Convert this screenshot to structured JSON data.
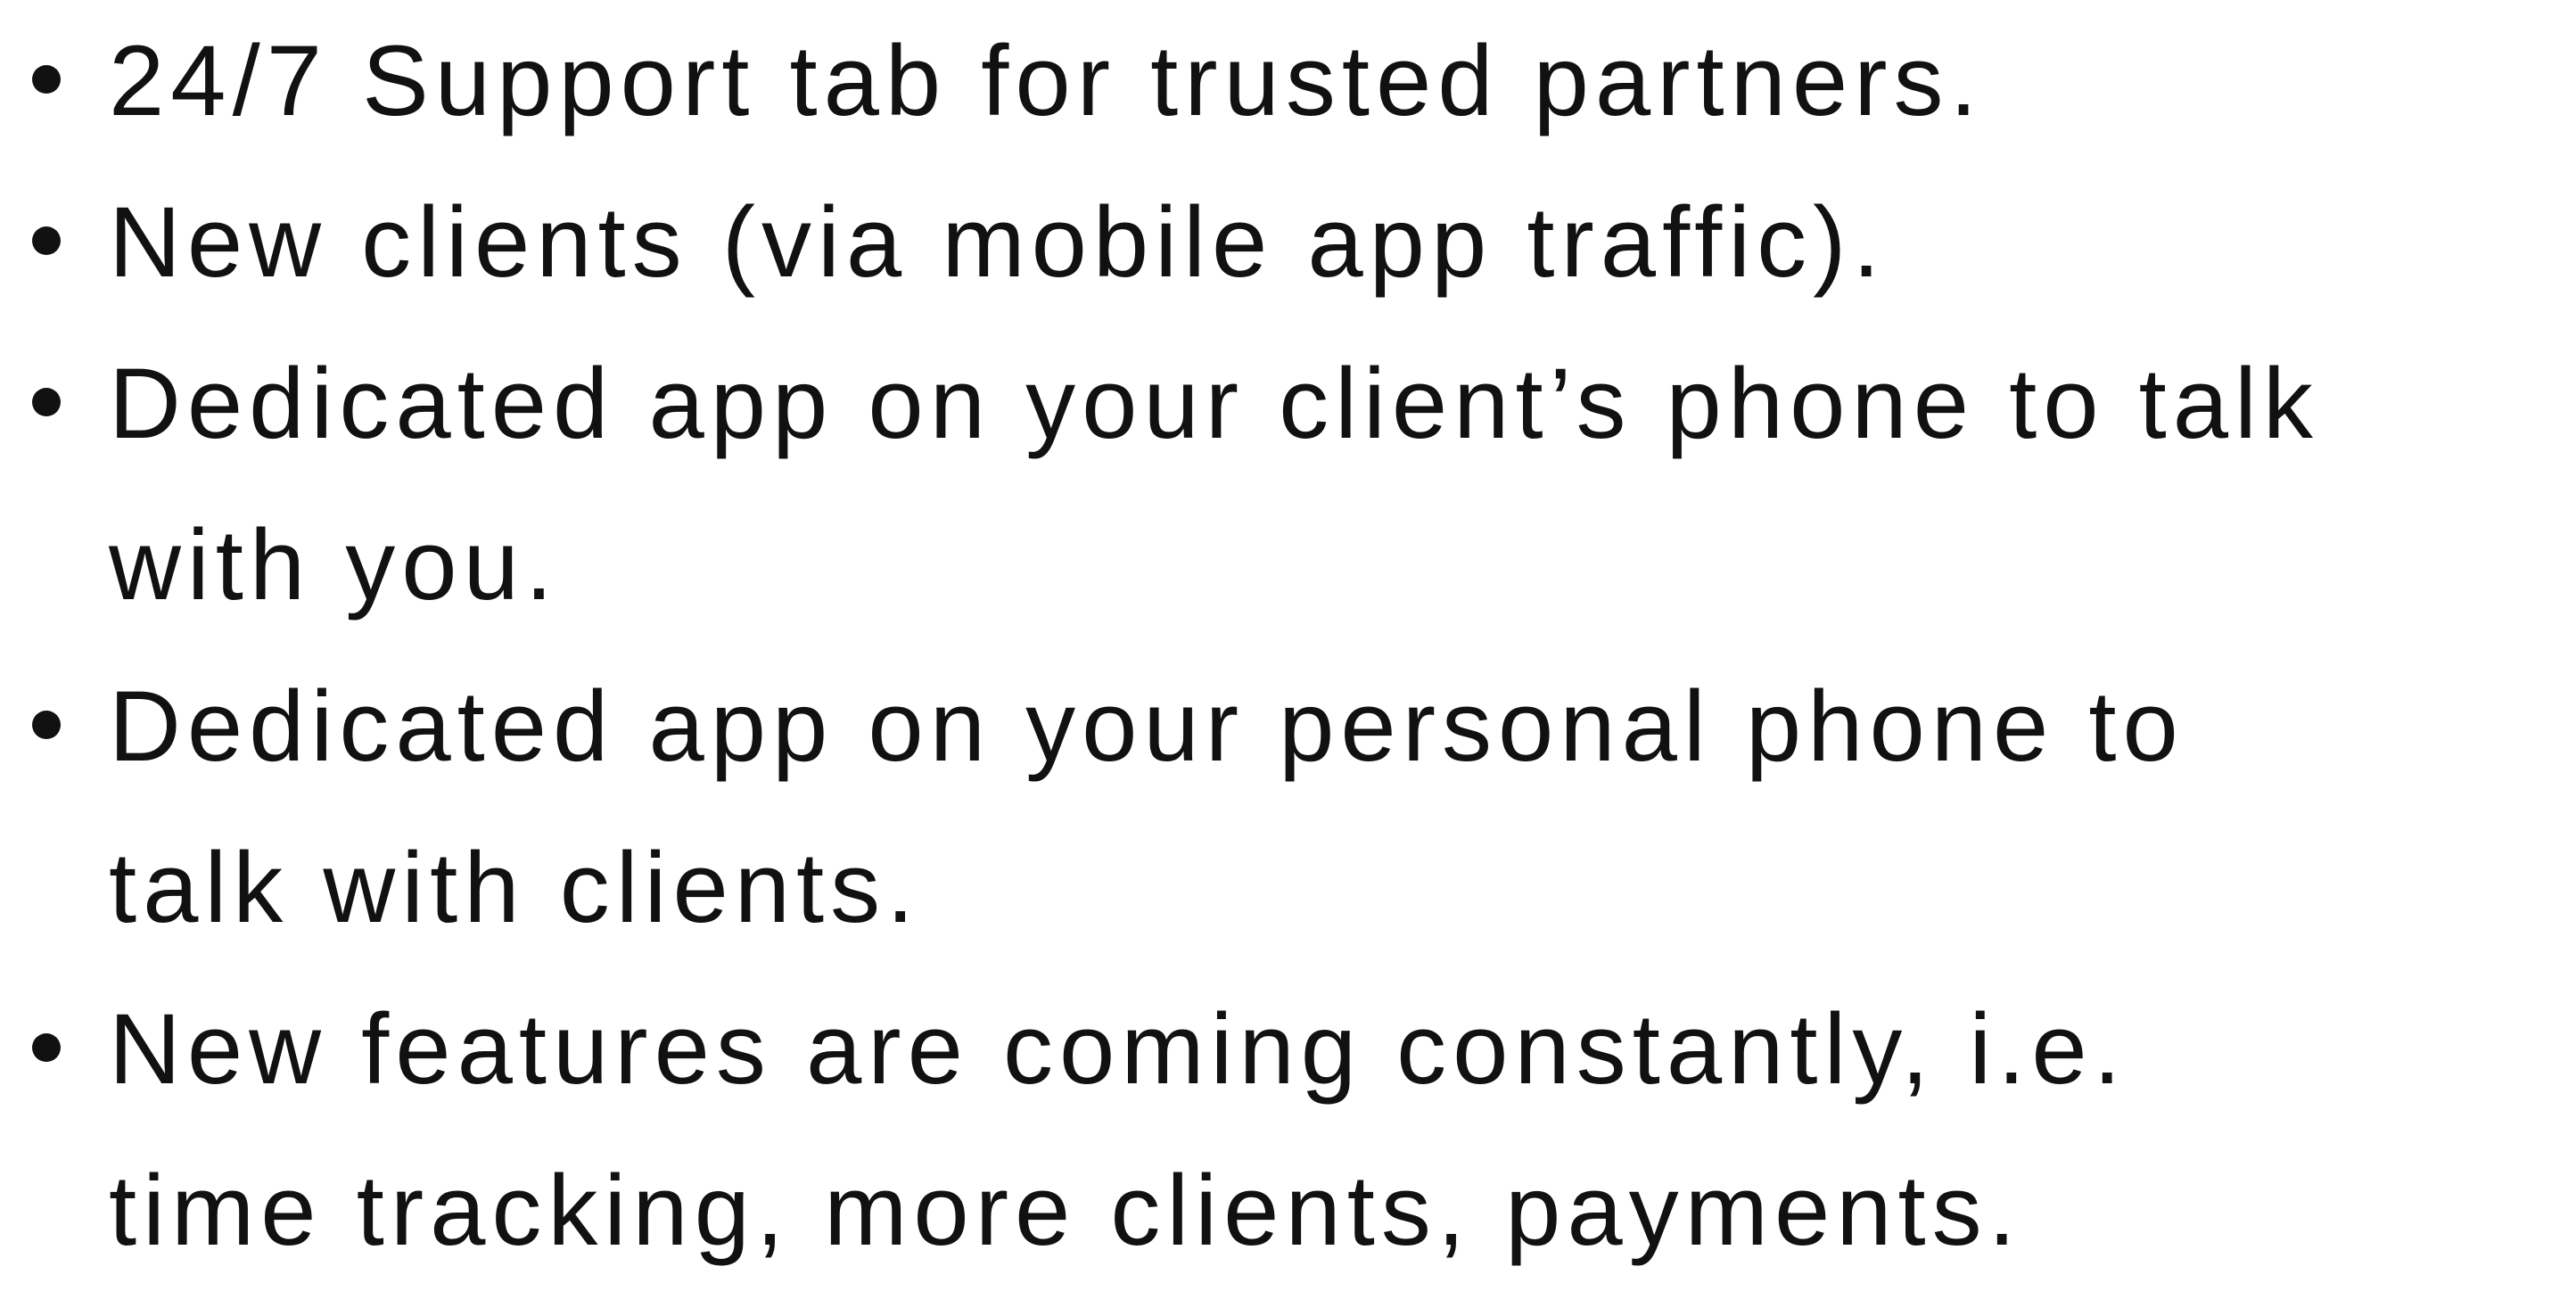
{
  "bullets": [
    {
      "lines": [
        "24/7 Support tab for trusted partners."
      ]
    },
    {
      "lines": [
        "New clients (via mobile app traffic)."
      ]
    },
    {
      "lines": [
        "Dedicated app on your client’s phone to talk",
        "with you."
      ]
    },
    {
      "lines": [
        "Dedicated app on your personal phone to",
        "talk with clients."
      ]
    },
    {
      "lines": [
        "New features are coming constantly, i.e.",
        "time tracking, more clients, payments."
      ]
    }
  ]
}
